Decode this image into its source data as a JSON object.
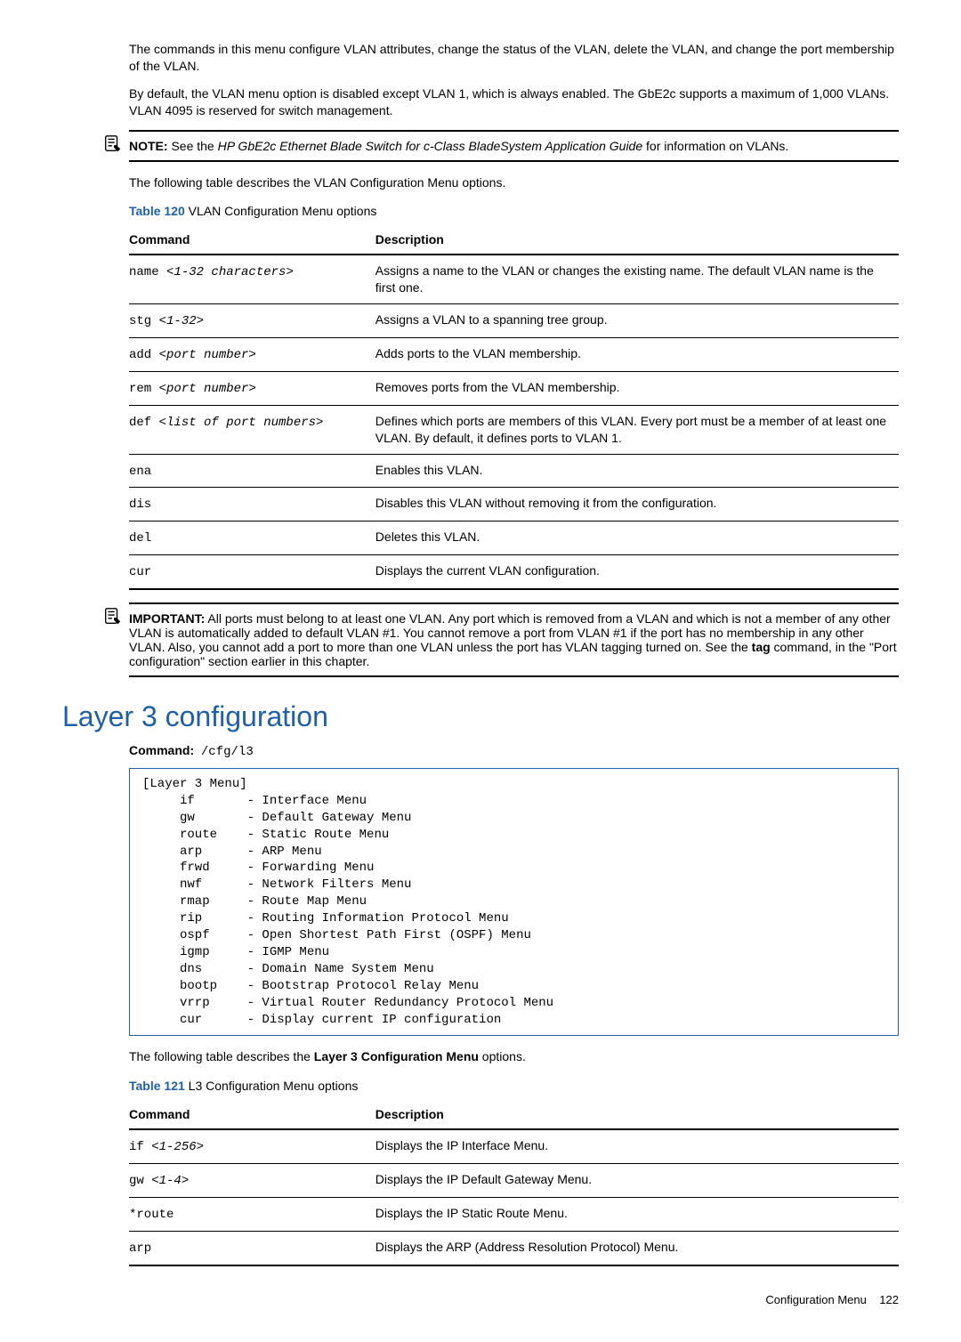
{
  "intro": {
    "p1": "The commands in this menu configure VLAN attributes, change the status of the VLAN, delete the VLAN, and change the port membership of the VLAN.",
    "p2": "By default, the VLAN menu option is disabled except VLAN 1, which is always enabled. The GbE2c supports a maximum of 1,000 VLANs. VLAN 4095 is reserved for switch management."
  },
  "note1": {
    "bold": "NOTE:",
    "lead": "  See the ",
    "italic": "HP GbE2c Ethernet Blade Switch for c-Class BladeSystem Application Guide",
    "tail": " for information on VLANs."
  },
  "table120_intro": "The following table describes the VLAN Configuration Menu options.",
  "table120_caption_num": "Table 120",
  "table120_caption_txt": "  VLAN Configuration Menu options",
  "table_headers": {
    "command": "Command",
    "description": "Description"
  },
  "table120_rows": [
    {
      "cmd_a": "name ",
      "cmd_i": "<1-32 characters>",
      "desc": "Assigns a name to the VLAN or changes the existing name. The default VLAN name is the first one."
    },
    {
      "cmd_a": "stg ",
      "cmd_i": "<1-32>",
      "desc": "Assigns a VLAN to a spanning tree group."
    },
    {
      "cmd_a": "add ",
      "cmd_i": "<port number>",
      "desc": "Adds ports to the VLAN membership."
    },
    {
      "cmd_a": "rem ",
      "cmd_i": "<port number>",
      "desc": "Removes ports from the VLAN membership."
    },
    {
      "cmd_a": "def ",
      "cmd_i": "<list of port numbers>",
      "desc": "Defines which ports are members of this VLAN. Every port must be a member of at least one VLAN. By default, it defines ports to VLAN 1."
    },
    {
      "cmd_a": "ena",
      "cmd_i": "",
      "desc": "Enables this VLAN."
    },
    {
      "cmd_a": "dis",
      "cmd_i": "",
      "desc": "Disables this VLAN without removing it from the configuration."
    },
    {
      "cmd_a": "del",
      "cmd_i": "",
      "desc": "Deletes this VLAN."
    },
    {
      "cmd_a": "cur",
      "cmd_i": "",
      "desc": "Displays the current VLAN configuration."
    }
  ],
  "important": {
    "bold": "IMPORTANT:",
    "p_pre": "  All ports must belong to at least one VLAN. Any port which is removed from a VLAN and which is not a member of any other VLAN is automatically added to default VLAN #1. You cannot remove a port from VLAN #1 if the port has no membership in any other VLAN. Also, you cannot add a port to more than one VLAN unless the port has VLAN tagging turned on. See the ",
    "p_bold": "tag",
    "p_post": " command, in the \"Port configuration\" section earlier in this chapter."
  },
  "section_title": "Layer 3 configuration",
  "cmd_label": "Command:",
  "cmd_path": "/cfg/l3",
  "codebox": "[Layer 3 Menu]\n     if       - Interface Menu\n     gw       - Default Gateway Menu\n     route    - Static Route Menu\n     arp      - ARP Menu\n     frwd     - Forwarding Menu\n     nwf      - Network Filters Menu\n     rmap     - Route Map Menu\n     rip      - Routing Information Protocol Menu\n     ospf     - Open Shortest Path First (OSPF) Menu\n     igmp     - IGMP Menu\n     dns      - Domain Name System Menu\n     bootp    - Bootstrap Protocol Relay Menu\n     vrrp     - Virtual Router Redundancy Protocol Menu\n     cur      - Display current IP configuration",
  "table121_intro_pre": "The following table describes the ",
  "table121_intro_bold": "Layer 3 Configuration Menu",
  "table121_intro_post": " options.",
  "table121_caption_num": "Table 121",
  "table121_caption_txt": "  L3 Configuration Menu options",
  "table121_rows": [
    {
      "cmd_a": "if ",
      "cmd_i": "<1-256>",
      "desc": "Displays the IP Interface Menu."
    },
    {
      "cmd_a": "gw ",
      "cmd_i": "<1-4>",
      "desc": "Displays the IP Default Gateway Menu."
    },
    {
      "cmd_a": "*route",
      "cmd_i": "",
      "desc": "Displays the IP Static Route Menu."
    },
    {
      "cmd_a": "arp",
      "cmd_i": "",
      "desc": "Displays the ARP (Address Resolution Protocol) Menu."
    }
  ],
  "footer": {
    "left": "Configuration Menu",
    "right": "122"
  }
}
